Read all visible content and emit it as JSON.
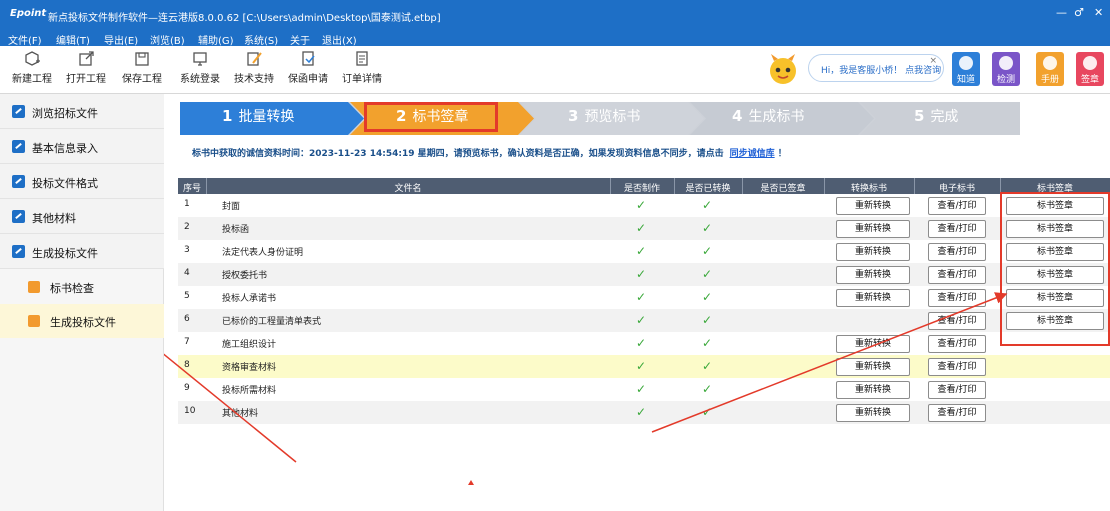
{
  "app": {
    "logo": "Epoint",
    "title": "新点投标文件制作软件—连云港版8.0.0.62   [C:\\Users\\admin\\Desktop\\国泰测试.etbp]",
    "window_buttons": [
      "—",
      "♂",
      "✕"
    ]
  },
  "menu": [
    "文件(F)",
    "编辑(T)",
    "导出(E)",
    "浏览(B)",
    "辅助(G)",
    "系统(S)",
    "关于",
    "退出(X)"
  ],
  "toolbar": [
    {
      "label": "新建工程",
      "icon": "new-project-icon"
    },
    {
      "label": "打开工程",
      "icon": "open-project-icon"
    },
    {
      "label": "保存工程",
      "icon": "save-project-icon"
    },
    {
      "label": "系统登录",
      "icon": "system-login-icon"
    },
    {
      "label": "技术支持",
      "icon": "tech-support-icon"
    },
    {
      "label": "保函申请",
      "icon": "guarantee-apply-icon"
    },
    {
      "label": "订单详情",
      "icon": "order-detail-icon"
    }
  ],
  "assistant": {
    "bubble": "Hi，我是客服小桥！  点我咨询",
    "close": "×"
  },
  "quick_buttons": [
    {
      "label": "知道",
      "color": "#2d7fd8"
    },
    {
      "label": "检测",
      "color": "#7a55c8"
    },
    {
      "label": "手册",
      "color": "#f2a12d"
    },
    {
      "label": "签章",
      "color": "#e8475f"
    }
  ],
  "sidebar": {
    "items": [
      {
        "label": "浏览招标文件"
      },
      {
        "label": "基本信息录入"
      },
      {
        "label": "投标文件格式"
      },
      {
        "label": "其他材料"
      },
      {
        "label": "生成投标文件"
      }
    ],
    "subitems": [
      {
        "label": "标书检查"
      },
      {
        "label": "生成投标文件"
      }
    ]
  },
  "steps": [
    {
      "num": "1",
      "label": "批量转换",
      "state": "done"
    },
    {
      "num": "2",
      "label": "标书签章",
      "state": "active"
    },
    {
      "num": "3",
      "label": "预览标书",
      "state": "pending"
    },
    {
      "num": "4",
      "label": "生成标书",
      "state": "pending"
    },
    {
      "num": "5",
      "label": "完成",
      "state": "pending"
    }
  ],
  "notice": {
    "text": "标书中获取的诚信资料时间：2023-11-23 14:54:19 星期四，请预览标书，确认资料是否正确，如果发现资料信息不同步，请点击",
    "link": "同步诚信库",
    "suffix": "！"
  },
  "table": {
    "headers": [
      "序号",
      "文件名",
      "是否制作",
      "是否已转换",
      "是否已签章",
      "转换标书",
      "电子标书",
      "标书签章"
    ],
    "convert_label": "重新转换",
    "view_label": "查看/打印",
    "sign_label": "标书签章",
    "check_glyph": "✓",
    "rows": [
      {
        "no": "1",
        "name": "封面",
        "made": true,
        "converted": true,
        "convert": true,
        "view": true,
        "sign": true
      },
      {
        "no": "2",
        "name": "投标函",
        "made": true,
        "converted": true,
        "convert": true,
        "view": true,
        "sign": true
      },
      {
        "no": "3",
        "name": "法定代表人身份证明",
        "made": true,
        "converted": true,
        "convert": true,
        "view": true,
        "sign": true
      },
      {
        "no": "4",
        "name": "授权委托书",
        "made": true,
        "converted": true,
        "convert": true,
        "view": true,
        "sign": true
      },
      {
        "no": "5",
        "name": "投标人承诺书",
        "made": true,
        "converted": true,
        "convert": true,
        "view": true,
        "sign": true
      },
      {
        "no": "6",
        "name": "已标价的工程量清单表式",
        "made": true,
        "converted": true,
        "convert": false,
        "view": true,
        "sign": true
      },
      {
        "no": "7",
        "name": "施工组织设计",
        "made": true,
        "converted": true,
        "convert": true,
        "view": true,
        "sign": false
      },
      {
        "no": "8",
        "name": "资格审查材料",
        "made": true,
        "converted": true,
        "convert": true,
        "view": true,
        "sign": false,
        "highlight": true
      },
      {
        "no": "9",
        "name": "投标所需材料",
        "made": true,
        "converted": true,
        "convert": true,
        "view": true,
        "sign": false
      },
      {
        "no": "10",
        "name": "其他材料",
        "made": true,
        "converted": true,
        "convert": true,
        "view": true,
        "sign": false
      }
    ]
  },
  "colors": {
    "brand": "#1e6fc6",
    "step_active": "#f2a12d",
    "step_done": "#2d7fd8",
    "annotation": "#e33a2a",
    "check": "#3aa83a"
  }
}
